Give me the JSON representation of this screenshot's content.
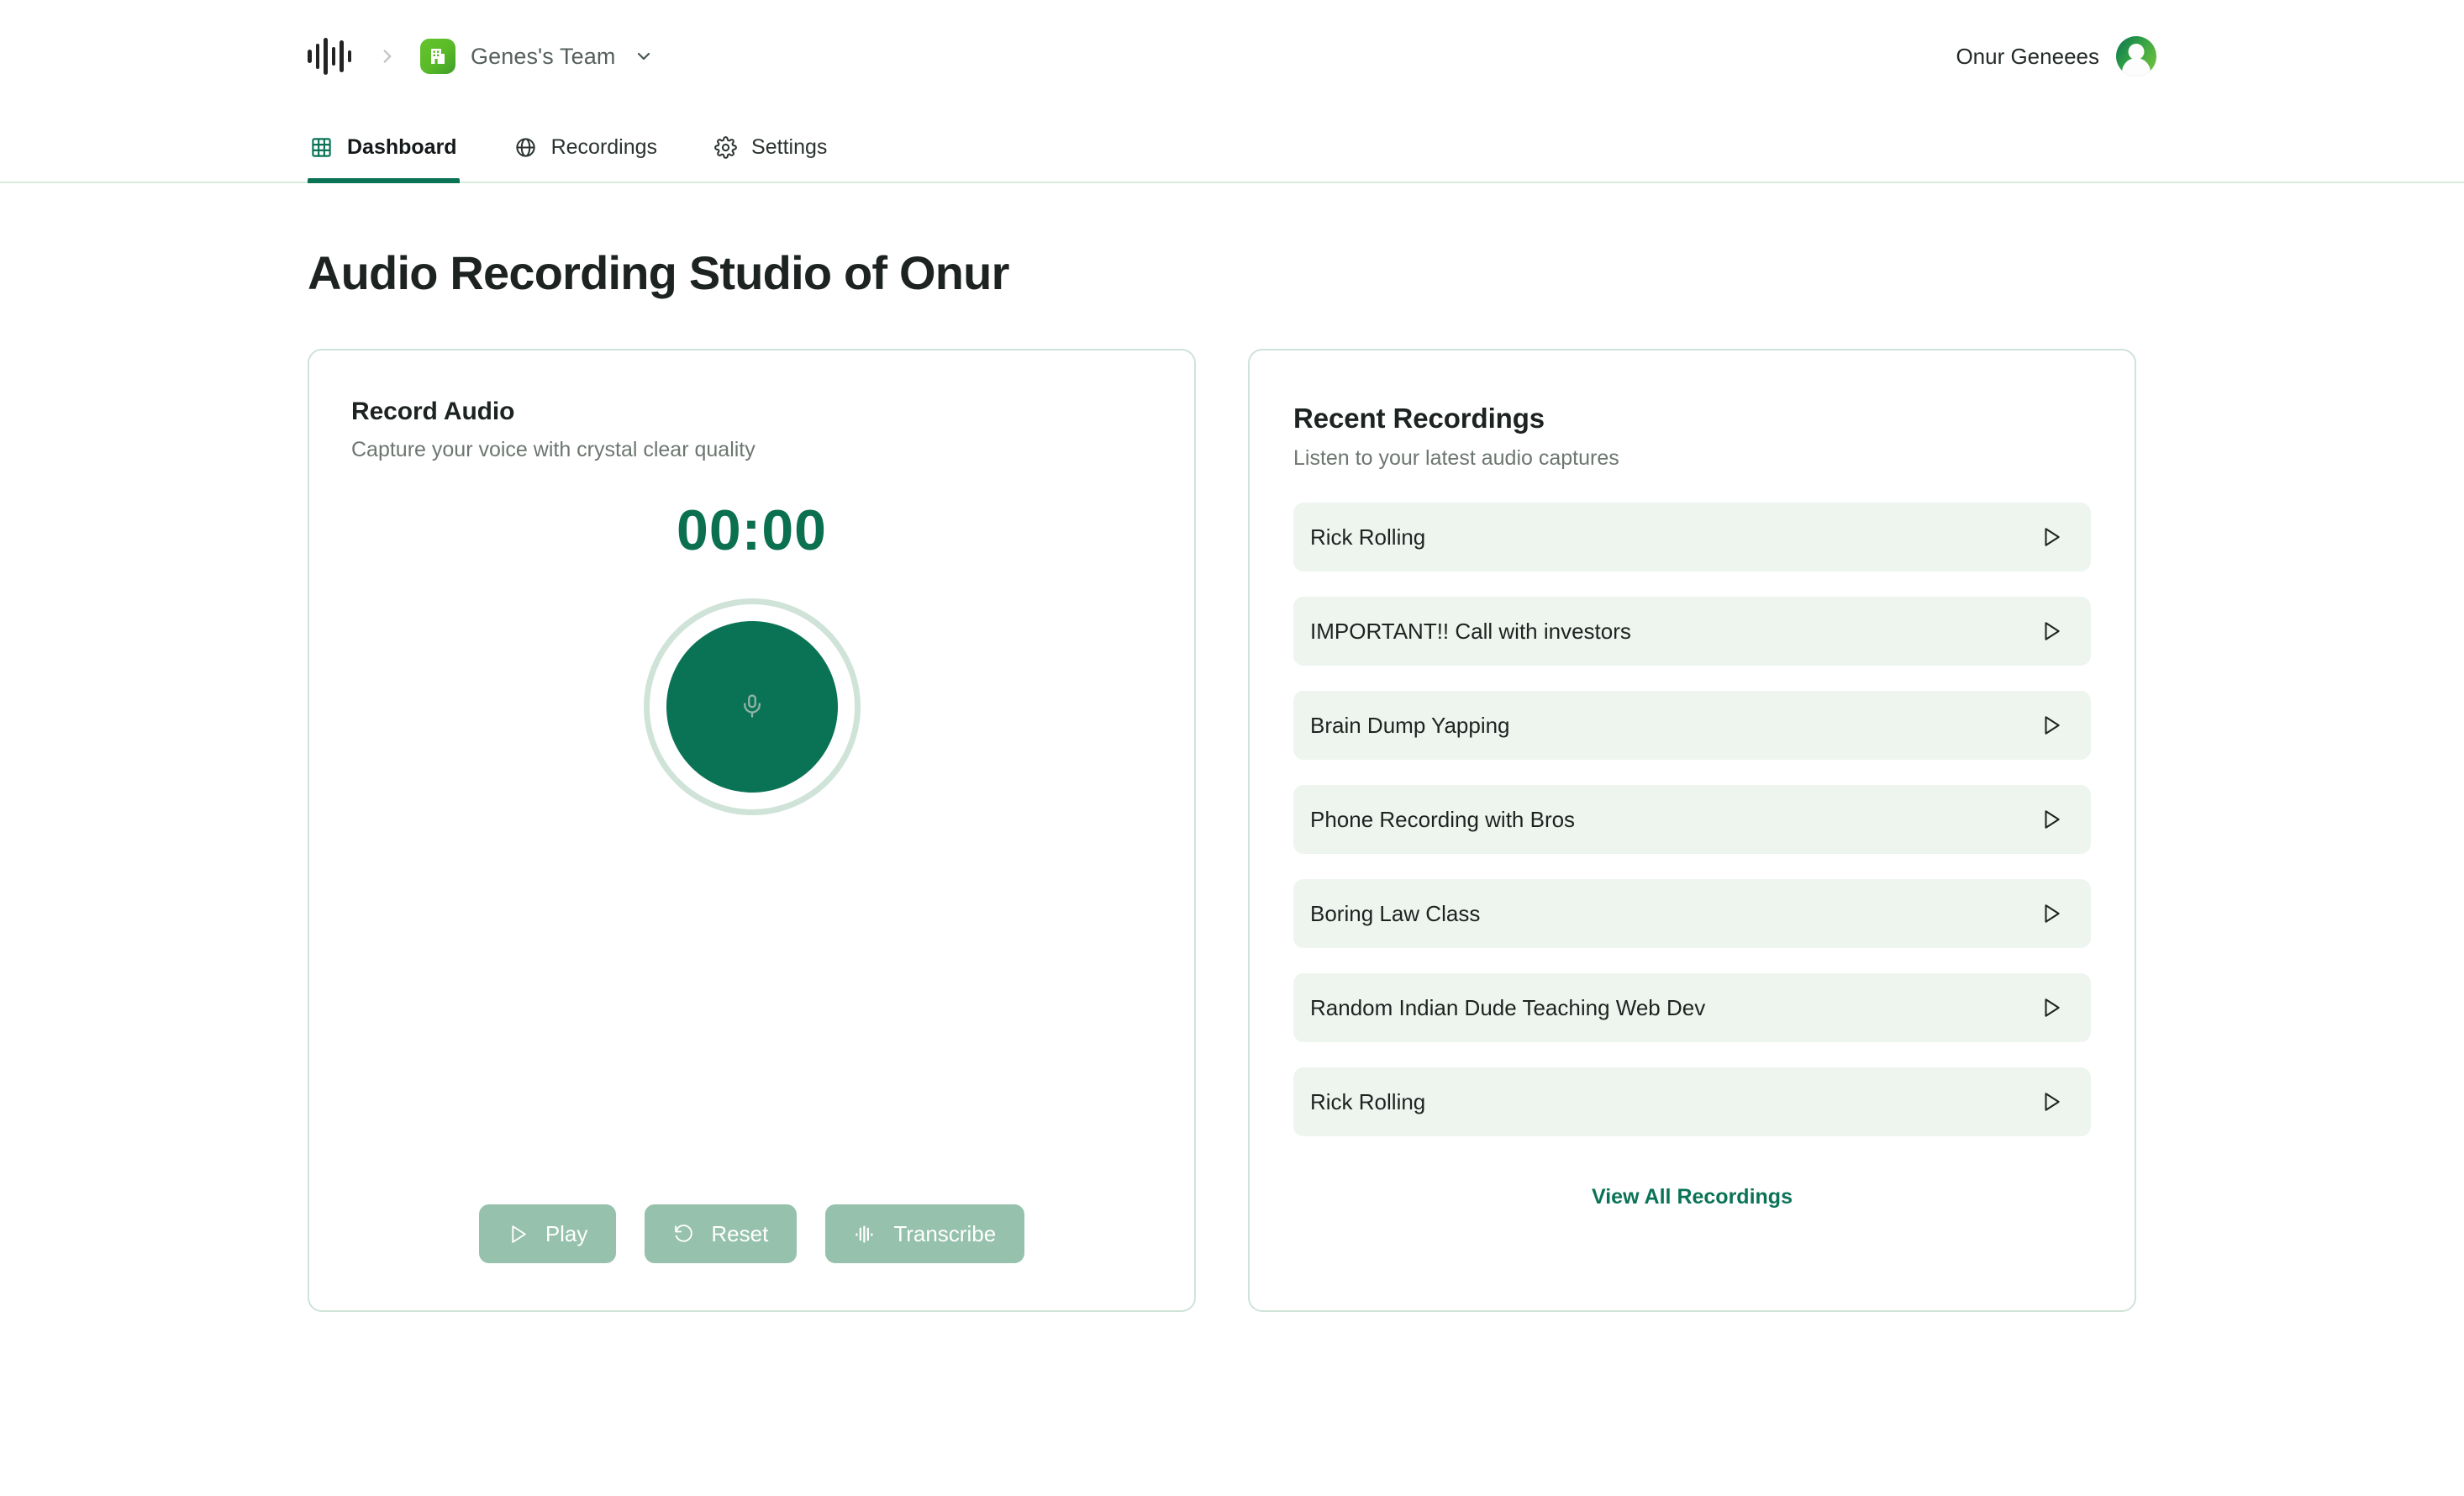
{
  "header": {
    "logo_icon": "waveform-icon",
    "breadcrumb_separator_icon": "chevron-right-icon",
    "team_icon": "building-icon",
    "team_name": "Genes's Team",
    "team_dropdown_icon": "chevron-down-icon",
    "user_name": "Onur Geneees",
    "avatar_icon": "user-avatar"
  },
  "tabs": [
    {
      "label": "Dashboard",
      "icon": "grid-icon",
      "active": true
    },
    {
      "label": "Recordings",
      "icon": "globe-icon",
      "active": false
    },
    {
      "label": "Settings",
      "icon": "gear-icon",
      "active": false
    }
  ],
  "page": {
    "title": "Audio Recording Studio of Onur"
  },
  "record_card": {
    "title": "Record Audio",
    "subtitle": "Capture your voice with crystal clear quality",
    "timer": "00:00",
    "record_button_icon": "microphone-icon",
    "buttons": [
      {
        "label": "Play",
        "icon": "play-icon"
      },
      {
        "label": "Reset",
        "icon": "rotate-ccw-icon"
      },
      {
        "label": "Transcribe",
        "icon": "waveform-icon"
      }
    ]
  },
  "recent_card": {
    "title": "Recent Recordings",
    "subtitle": "Listen to your latest audio captures",
    "recordings": [
      {
        "name": "Rick Rolling",
        "play_icon": "play-icon"
      },
      {
        "name": "IMPORTANT!! Call with investors",
        "play_icon": "play-icon"
      },
      {
        "name": "Brain Dump Yapping",
        "play_icon": "play-icon"
      },
      {
        "name": "Phone Recording with Bros",
        "play_icon": "play-icon"
      },
      {
        "name": "Boring Law Class",
        "play_icon": "play-icon"
      },
      {
        "name": "Random Indian Dude Teaching Web Dev",
        "play_icon": "play-icon"
      },
      {
        "name": "Rick Rolling",
        "play_icon": "play-icon"
      }
    ],
    "view_all_label": "View All Recordings"
  },
  "colors": {
    "brand_green": "#0b7355",
    "accent_light": "#96c1ad",
    "row_bg": "#eef5ef",
    "border": "#cfe3d8",
    "team_icon_green": "#59b928"
  }
}
